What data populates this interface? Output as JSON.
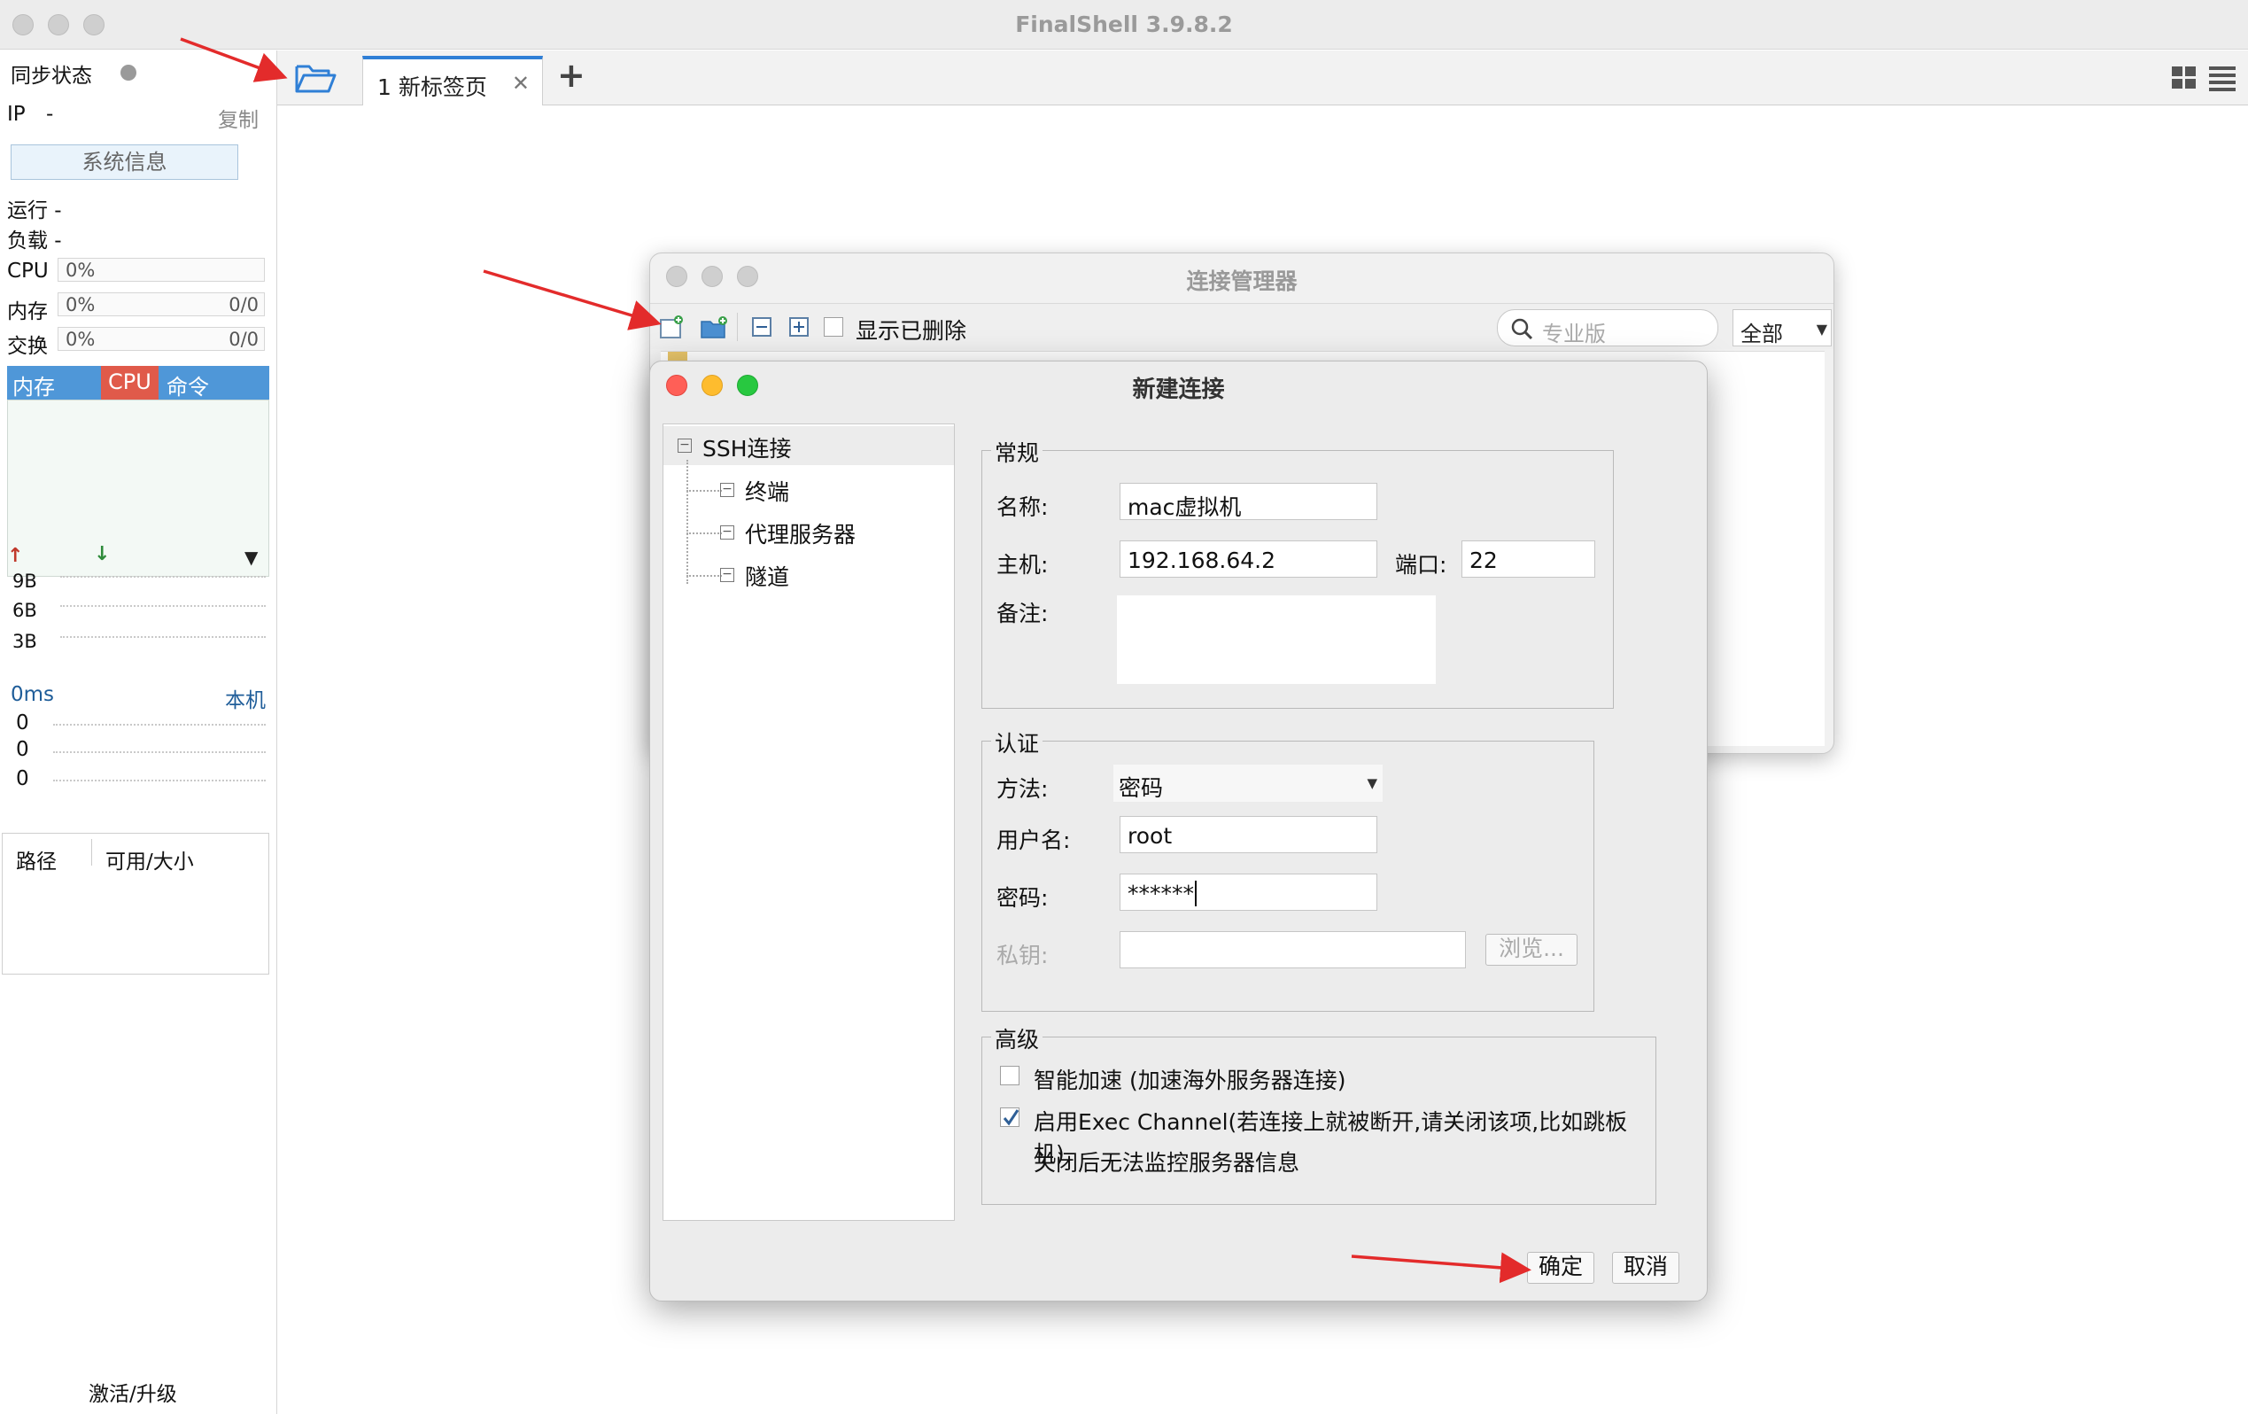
{
  "app": {
    "title": "FinalShell 3.9.8.2"
  },
  "tabs": {
    "items": [
      {
        "label": "1 新标签页"
      }
    ],
    "add": "+"
  },
  "sidebar": {
    "sync_label": "同步状态",
    "ip_label": "IP",
    "ip_value": "-",
    "copy_label": "复制",
    "sysinfo_button": "系统信息",
    "uptime_label": "运行 -",
    "load_label": "负载 -",
    "cpu": {
      "label": "CPU",
      "value": "0%"
    },
    "mem": {
      "label": "内存",
      "value": "0%",
      "ratio": "0/0"
    },
    "swap": {
      "label": "交换",
      "value": "0%",
      "ratio": "0/0"
    },
    "proc_tabs": [
      "内存",
      "CPU",
      "命令"
    ],
    "net_ticks": [
      "9B",
      "6B",
      "3B"
    ],
    "ping": {
      "label": "0ms",
      "host": "本机",
      "ticks": [
        "0",
        "0",
        "0"
      ]
    },
    "disk_headers": [
      "路径",
      "可用/大小"
    ],
    "activate_label": "激活/升级"
  },
  "conn_manager": {
    "title": "连接管理器",
    "show_deleted_label": "显示已删除",
    "search_placeholder": "专业版",
    "filter_value": "全部"
  },
  "new_conn": {
    "title": "新建连接",
    "tree": {
      "root": "SSH连接",
      "children": [
        "终端",
        "代理服务器",
        "隧道"
      ]
    },
    "general": {
      "title": "常规",
      "name_label": "名称:",
      "name_value": "mac虚拟机",
      "host_label": "主机:",
      "host_value": "192.168.64.2",
      "port_label": "端口:",
      "port_value": "22",
      "note_label": "备注:"
    },
    "auth": {
      "title": "认证",
      "method_label": "方法:",
      "method_value": "密码",
      "user_label": "用户名:",
      "user_value": "root",
      "password_label": "密码:",
      "password_value": "******",
      "key_label": "私钥:",
      "browse_button": "浏览..."
    },
    "advanced": {
      "title": "高级",
      "smart_accel": {
        "label": "智能加速 (加速海外服务器连接)",
        "checked": false
      },
      "exec_channel": {
        "label": "启用Exec Channel(若连接上就被断开,请关闭该项,比如跳板机)",
        "checked": true
      },
      "exec_note": "关闭后无法监控服务器信息"
    },
    "ok_button": "确定",
    "cancel_button": "取消"
  },
  "colors": {
    "accent": "#2f7fd6",
    "arrow": "#e32b2b",
    "proc_tab": "#4f97d8",
    "cpu_tab": "#e05a4a"
  }
}
